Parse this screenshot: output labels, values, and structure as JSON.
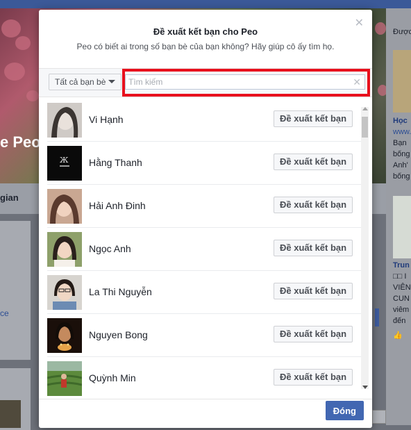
{
  "background": {
    "profile_name": "e Peo",
    "tab_label": "gian",
    "right_column": {
      "top_label": "Được",
      "title": "Học",
      "link": "www.",
      "lines": [
        "Bạn",
        "bống",
        "Anh'",
        "bống"
      ],
      "sponsor_title": "Trun",
      "sponsor_lines": [
        "□□ I",
        "VIÊN",
        "CUN",
        "viêm",
        "đến"
      ]
    },
    "left_link": "ce"
  },
  "modal": {
    "title": "Đề xuất kết bạn cho Peo",
    "subtitle": "Peo có biết ai trong số bạn bè của bạn không? Hãy giúp cô ấy tìm họ.",
    "filter_label": "Tất cả bạn bè",
    "search": {
      "placeholder": "Tìm kiếm",
      "value": ""
    },
    "suggest_label": "Đề xuất kết bạn",
    "friends": [
      {
        "name": "Vi Hạnh"
      },
      {
        "name": "Hằng Thanh"
      },
      {
        "name": "Hải Anh Đinh"
      },
      {
        "name": "Ngọc Anh"
      },
      {
        "name": "La Thi Nguyễn"
      },
      {
        "name": "Nguyen Bong"
      },
      {
        "name": "Quỳnh Min"
      }
    ],
    "done_label": "Đóng"
  },
  "colors": {
    "brand_blue": "#4267b2",
    "highlight_red": "#e8101d"
  }
}
